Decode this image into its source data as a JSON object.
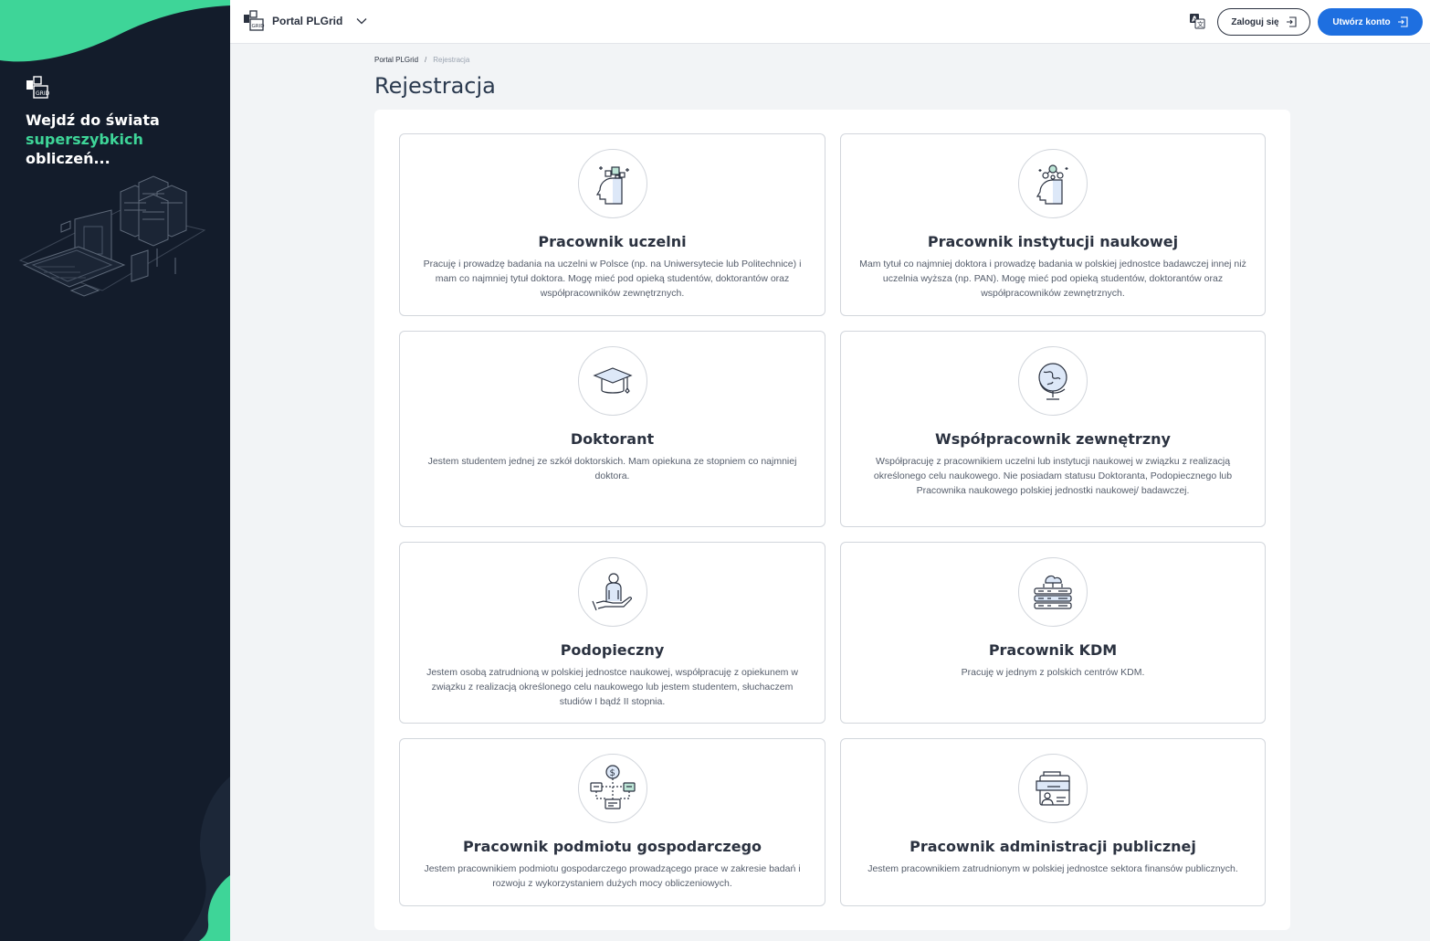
{
  "sidebar": {
    "tagline_line1": "Wejdź do świata",
    "tagline_accent": "superszybkich",
    "tagline_line3": "obliczeń...",
    "accent_color": "#3ed598",
    "background_color": "#131c2b",
    "illustration": "computer-servers-illustration"
  },
  "header": {
    "brand_name": "Portal PLGrid",
    "brand_icon": "plgrid-logo-icon",
    "menu_icon": "chevron-down-icon",
    "language_icon": "translate-icon",
    "login_label": "Zaloguj się",
    "login_icon": "login-icon",
    "create_label": "Utwórz konto",
    "create_icon": "login-icon",
    "primary_color": "#1e6fe0"
  },
  "breadcrumb": {
    "items": [
      "Portal PLGrid",
      "Rejestracja"
    ],
    "separator": "/"
  },
  "page": {
    "title": "Rejestracja"
  },
  "cards": [
    {
      "title": "Pracownik uczelni",
      "icon": "head-blocks-icon",
      "description": "Pracuję i prowadzę badania na uczelni w Polsce (np. na Uniwersytecie lub Politechnice) i mam co najmniej tytuł doktora. Mogę mieć pod opieką studentów, doktorantów oraz współpracowników zewnętrznych."
    },
    {
      "title": "Pracownik instytucji naukowej",
      "icon": "head-molecule-icon",
      "description": "Mam tytuł co najmniej doktora i prowadzę badania w polskiej jednostce badawczej innej niż uczelnia wyższa (np. PAN). Mogę mieć pod opieką studentów, doktorantów oraz współpracowników zewnętrznych."
    },
    {
      "title": "Doktorant",
      "icon": "graduation-cap-icon",
      "description": "Jestem studentem jednej ze szkół doktorskich. Mam opiekuna ze stopniem co najmniej doktora."
    },
    {
      "title": "Współpracownik zewnętrzny",
      "icon": "globe-icon",
      "description": "Współpracuję z pracownikiem uczelni lub instytucji naukowej w związku z realizacją określonego celu naukowego. Nie posiadam statusu Doktoranta, Podopiecznego lub Pracownika naukowego polskiej jednostki naukowej/ badawczej."
    },
    {
      "title": "Podopieczny",
      "icon": "hand-person-icon",
      "description": "Jestem osobą zatrudnioną w polskiej jednostce naukowej, współpracuję z opiekunem w związku z realizacją określonego celu naukowego lub jestem studentem, słuchaczem studiów I bądź II stopnia."
    },
    {
      "title": "Pracownik KDM",
      "icon": "cloud-server-icon",
      "description": "Pracuję w jednym z polskich centrów KDM."
    },
    {
      "title": "Pracownik podmiotu gospodarczego",
      "icon": "business-dollar-icon",
      "description": "Jestem pracownikiem podmiotu gospodarczego prowadzącego prace w zakresie badań i rozwoju z wykorzystaniem dużych mocy obliczeniowych."
    },
    {
      "title": "Pracownik administracji publicznej",
      "icon": "public-admin-icon",
      "description": "Jestem pracownikiem zatrudnionym w polskiej jednostce sektora finansów publicznych."
    }
  ]
}
